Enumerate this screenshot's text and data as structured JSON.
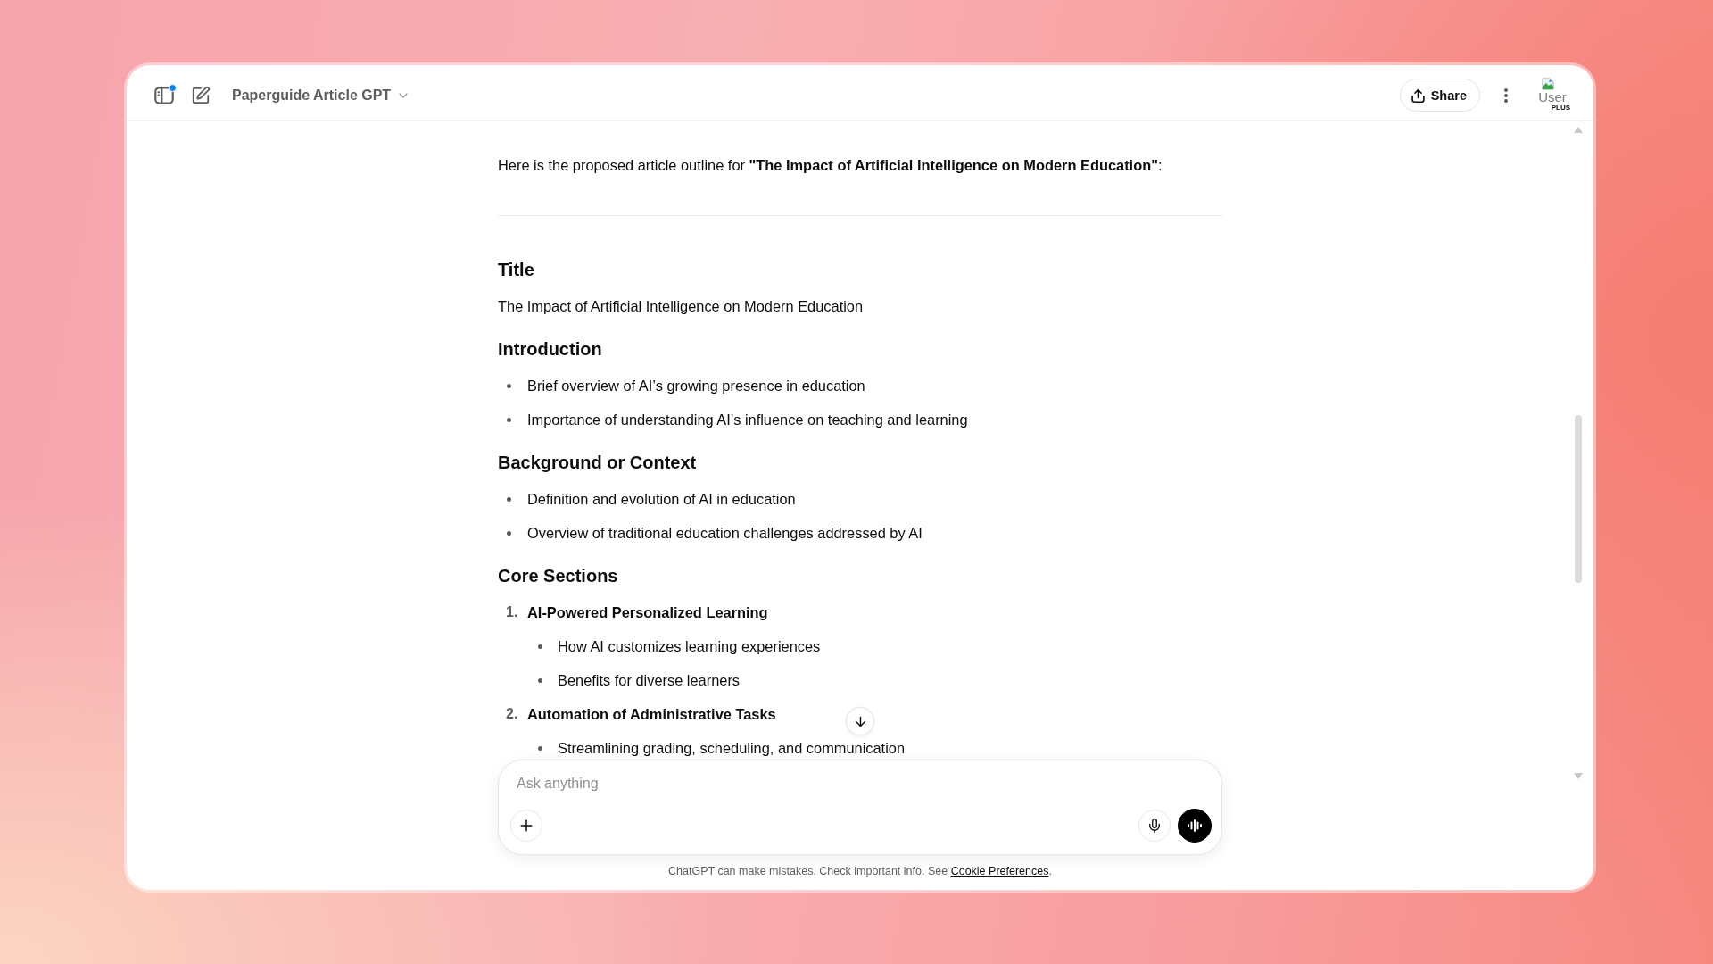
{
  "header": {
    "notification": true,
    "gpt_name": "Paperguide Article GPT",
    "share_label": "Share",
    "avatar": {
      "alt_text": "User",
      "badge": "PLUS"
    }
  },
  "conversation": {
    "intro": "Here is the proposed article outline for **\"The Impact of Artificial Intelligence on Modern Education\"**:",
    "sections": [
      {
        "kind": "paragraph",
        "heading": "Title",
        "text": "The Impact of Artificial Intelligence on Modern Education"
      },
      {
        "kind": "bullets",
        "heading": "Introduction",
        "items": [
          "Brief overview of AI’s growing presence in education",
          "Importance of understanding AI’s influence on teaching and learning"
        ]
      },
      {
        "kind": "bullets",
        "heading": "Background or Context",
        "items": [
          "Definition and evolution of AI in education",
          "Overview of traditional education challenges addressed by AI"
        ]
      },
      {
        "kind": "numbered",
        "heading": "Core Sections",
        "items": [
          {
            "number": "1.",
            "title": "AI-Powered Personalized Learning",
            "points": [
              "How AI customizes learning experiences",
              "Benefits for diverse learners"
            ]
          },
          {
            "number": "2.",
            "title": "Automation of Administrative Tasks",
            "points": [
              "Streamlining grading, scheduling, and communication"
            ]
          }
        ]
      }
    ]
  },
  "composer": {
    "placeholder": "Ask anything"
  },
  "disclaimer": {
    "text": "ChatGPT can make mistakes. Check important info. See",
    "link": "Cookie Preferences",
    "end": "."
  }
}
